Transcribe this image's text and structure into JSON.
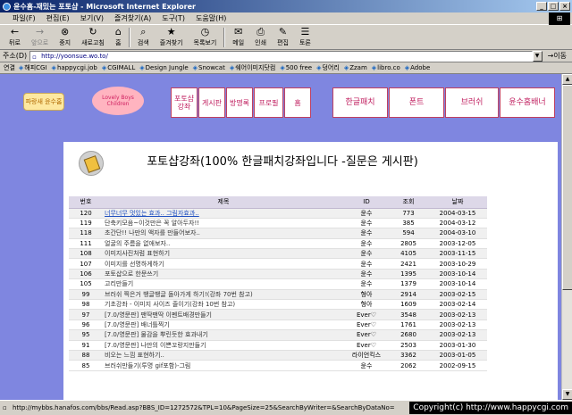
{
  "window": {
    "title": "윤수홈-재밌는 포토샵 - Microsoft Internet Explorer",
    "win_logo": "⊞"
  },
  "menu": [
    "파일(F)",
    "편집(E)",
    "보기(V)",
    "즐겨찾기(A)",
    "도구(T)",
    "도움말(H)"
  ],
  "toolbar": {
    "buttons": [
      {
        "label": "뒤로",
        "glyph": "←",
        "disabled": false
      },
      {
        "label": "앞으로",
        "glyph": "→",
        "disabled": true
      },
      {
        "label": "중지",
        "glyph": "⊗",
        "disabled": false
      },
      {
        "label": "새로고침",
        "glyph": "↻",
        "disabled": false
      },
      {
        "label": "홈",
        "glyph": "⌂",
        "disabled": false
      },
      {
        "label": "검색",
        "glyph": "⌕",
        "disabled": false
      },
      {
        "label": "즐겨찾기",
        "glyph": "★",
        "disabled": false
      },
      {
        "label": "목록보기",
        "glyph": "◷",
        "disabled": false
      },
      {
        "label": "메일",
        "glyph": "✉",
        "disabled": false
      },
      {
        "label": "인쇄",
        "glyph": "⎙",
        "disabled": false
      },
      {
        "label": "편집",
        "glyph": "✎",
        "disabled": false
      },
      {
        "label": "토론",
        "glyph": "☰",
        "disabled": false
      }
    ]
  },
  "address": {
    "label": "주소(D)",
    "url": "http://yoonsue.wo.to/",
    "go_label": "이동"
  },
  "links": {
    "label": "연결",
    "items": [
      "해피CGI",
      "happycgi.job",
      "CGIMALL",
      "Design Jungle",
      "Snowcat",
      "쉐어이미지닷컴",
      "500 free",
      "덩어리",
      "Zzam",
      "libro.co",
      "Adobe"
    ]
  },
  "banner": {
    "logo1": "파랑새 윤수홈",
    "logo2": "Lovely Boys Children",
    "nav_left": [
      "포토샵 강좌",
      "게시판",
      "방명록",
      "프로필",
      "홈"
    ],
    "nav_right": [
      "한글패치",
      "폰트",
      "브러쉬",
      "윤수홈배너"
    ]
  },
  "board": {
    "title": "포토샵강좌(100% 한글패치강좌입니다 -질문은 게시판)",
    "headers": {
      "num": "번호",
      "subject": "제목",
      "id": "ID",
      "views": "조회",
      "date": "날짜"
    },
    "rows": [
      {
        "num": "120",
        "subject": "너무너무 멋있는 효과.. 그림자효과..",
        "id": "윤수",
        "views": "773",
        "date": "2004-03-15"
      },
      {
        "num": "119",
        "subject": "단축키모음~이것만은 꼭 알아두자!!",
        "id": "윤수",
        "views": "385",
        "date": "2004-03-12"
      },
      {
        "num": "118",
        "subject": "초간단!! 나만의 액자를 만들어보자..",
        "id": "윤수",
        "views": "594",
        "date": "2004-03-10"
      },
      {
        "num": "111",
        "subject": "얼굴의 주름을 없애보자..",
        "id": "윤수",
        "views": "2805",
        "date": "2003-12-05"
      },
      {
        "num": "108",
        "subject": "이미지사진처럼 표현하기",
        "id": "윤수",
        "views": "4105",
        "date": "2003-11-15"
      },
      {
        "num": "107",
        "subject": "이미지를 선명하게하기",
        "id": "윤수",
        "views": "2421",
        "date": "2003-10-29"
      },
      {
        "num": "106",
        "subject": "포토샵으로 한문쓰기",
        "id": "윤수",
        "views": "1395",
        "date": "2003-10-14"
      },
      {
        "num": "105",
        "subject": "고리만들기",
        "id": "윤수",
        "views": "1379",
        "date": "2003-10-14"
      },
      {
        "num": "99",
        "subject": "브러쉬 찍은거 뱅글뱅글 돌아가게 하기!(강좌 70번 참고)",
        "id": "형아",
        "views": "2914",
        "date": "2003-02-15"
      },
      {
        "num": "98",
        "subject": "기초강좌 - 이미지 사이즈 줄이기(강좌 10번 참고)",
        "id": "형아",
        "views": "1609",
        "date": "2003-02-14"
      },
      {
        "num": "97",
        "subject": "[7.0/영문판] 팬딱팬딱 이펜트배경만들기",
        "id": "Ever♡",
        "views": "3548",
        "date": "2003-02-13"
      },
      {
        "num": "96",
        "subject": "[7.0/영문판] 배너틀찍기",
        "id": "Ever♡",
        "views": "1761",
        "date": "2003-02-13"
      },
      {
        "num": "95",
        "subject": "[7.0/영문판] 물감을 뿌린듯한 효과내기",
        "id": "Ever♡",
        "views": "2680",
        "date": "2003-02-13"
      },
      {
        "num": "91",
        "subject": "[7.0/영문판] 나만의 이쁜꼬랑지만들기",
        "id": "Ever♡",
        "views": "2503",
        "date": "2003-01-30"
      },
      {
        "num": "88",
        "subject": "비오는 느낌 표현하기..",
        "id": "라이언킥스",
        "views": "3362",
        "date": "2003-01-05"
      },
      {
        "num": "85",
        "subject": "브러쉬만들기(투명 gif포함)-그림",
        "id": "윤수",
        "views": "2062",
        "date": "2002-09-15"
      }
    ]
  },
  "status": {
    "url": "http://mybbs.hanafos.com/bbs/Read.asp?BBS_ID=1272572&TPL=10&PageSize=25&SearchByWriter=&SearchByDataNo=",
    "copyright": "Copyright(c) http://www.happycgi.com"
  },
  "icons": {
    "page": "page-icon",
    "ie": "ie-icon"
  }
}
